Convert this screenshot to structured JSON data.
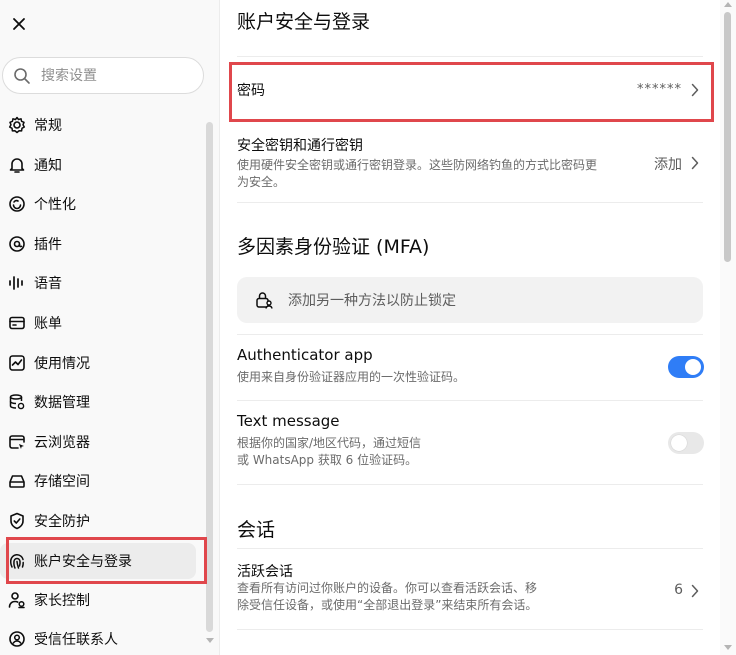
{
  "sidebar": {
    "close_icon": "close-icon",
    "search": {
      "placeholder": "搜索设置",
      "icon": "search-icon"
    },
    "items": [
      {
        "label": "常规",
        "icon": "gear-icon"
      },
      {
        "label": "通知",
        "icon": "bell-icon"
      },
      {
        "label": "个性化",
        "icon": "personalization-icon"
      },
      {
        "label": "插件",
        "icon": "plugin-icon"
      },
      {
        "label": "语音",
        "icon": "voice-icon"
      },
      {
        "label": "账单",
        "icon": "billing-icon"
      },
      {
        "label": "使用情况",
        "icon": "usage-icon"
      },
      {
        "label": "数据管理",
        "icon": "data-icon"
      },
      {
        "label": "云浏览器",
        "icon": "cloud-browser-icon"
      },
      {
        "label": "存储空间",
        "icon": "storage-icon"
      },
      {
        "label": "安全防护",
        "icon": "shield-icon"
      },
      {
        "label": "账户安全与登录",
        "icon": "fingerprint-icon",
        "active": true
      },
      {
        "label": "家长控制",
        "icon": "parental-icon"
      },
      {
        "label": "受信任联系人",
        "icon": "trusted-contact-icon"
      }
    ]
  },
  "main": {
    "title": "账户安全与登录",
    "password": {
      "label": "密码",
      "value": "******"
    },
    "passkeys": {
      "title": "安全密钥和通行密钥",
      "description_line1": "使用硬件安全密钥或通行密钥登录。这些防网络钓鱼的方式比密码更",
      "description_line2": "为安全。",
      "action": "添加"
    },
    "mfa": {
      "heading": "多因素身份验证 (MFA)",
      "add_method": "添加另一种方法以防止锁定",
      "authenticator": {
        "title": "Authenticator app",
        "description": "使用来自身份验证器应用的一次性验证码。",
        "enabled": true
      },
      "text_message": {
        "title": "Text message",
        "description_line1": "根据你的国家/地区代码，通过短信",
        "description_line2": "或 WhatsApp 获取 6 位验证码。",
        "enabled": false
      }
    },
    "sessions": {
      "heading": "会话",
      "active": {
        "title": "活跃会话",
        "description_line1": "查看所有访问过你账户的设备。你可以查看活跃会话、移",
        "description_line2": "除受信任设备，或使用“全部退出登录”来结束所有会话。",
        "count": "6"
      }
    }
  },
  "colors": {
    "accent": "#2f7df6",
    "highlight": "#e0474c"
  }
}
